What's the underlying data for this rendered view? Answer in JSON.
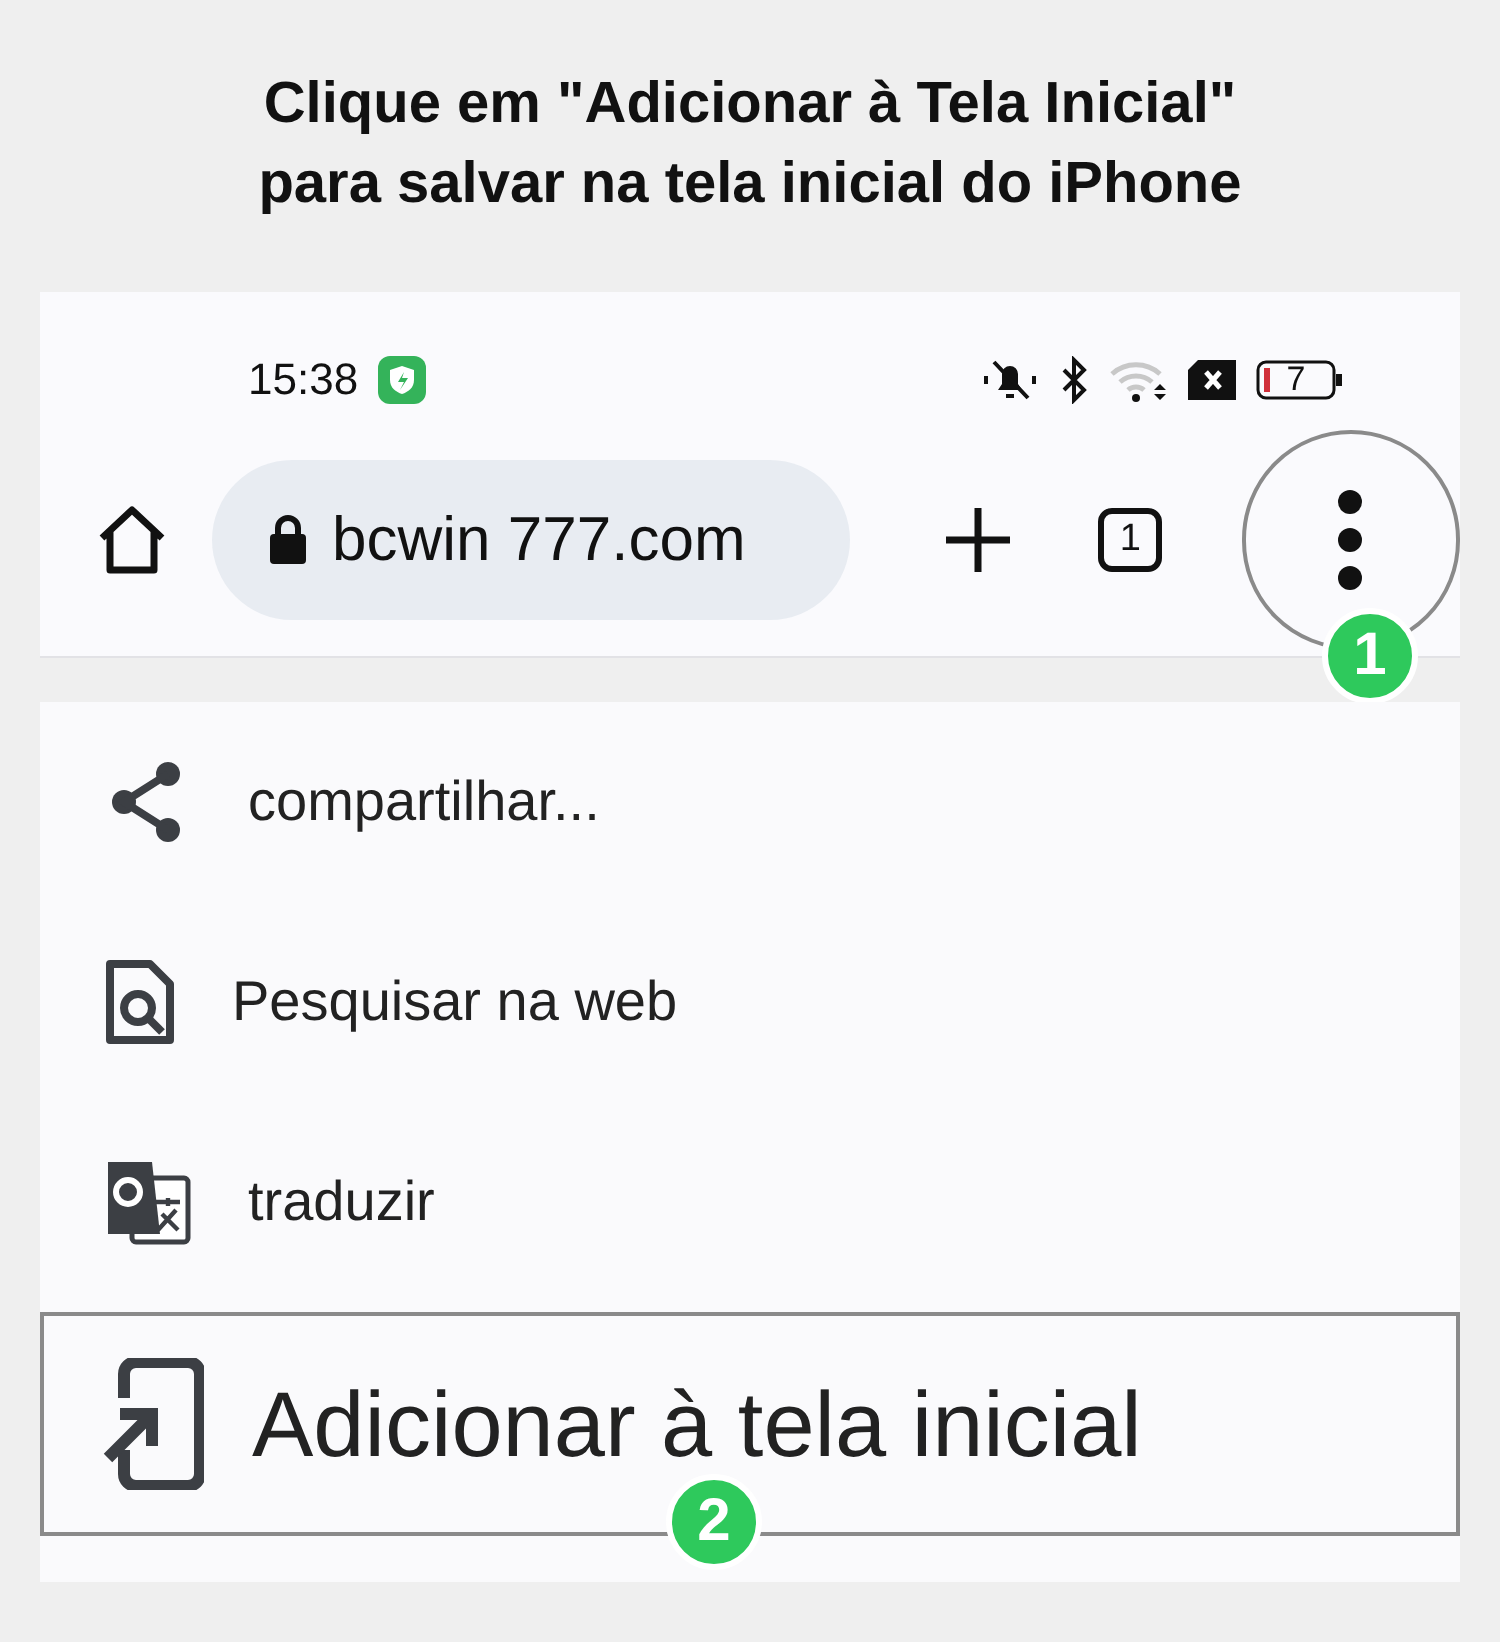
{
  "instruction": [
    "Clique em \"Adicionar à Tela Inicial\"",
    "para salvar na tela inicial do iPhone"
  ],
  "status_bar": {
    "time": "15:38",
    "battery": "7"
  },
  "toolbar": {
    "url": "bcwin 777.com",
    "tab_count": "1",
    "step": "1"
  },
  "menu": {
    "items": [
      {
        "kind": "share",
        "label": "compartilhar...",
        "selected": false
      },
      {
        "kind": "search-page",
        "label": "Pesquisar na web",
        "selected": false
      },
      {
        "kind": "translate",
        "label": "traduzir",
        "selected": false
      },
      {
        "kind": "add-home",
        "label": "Adicionar à tela inicial",
        "selected": true,
        "step": "2"
      }
    ]
  }
}
